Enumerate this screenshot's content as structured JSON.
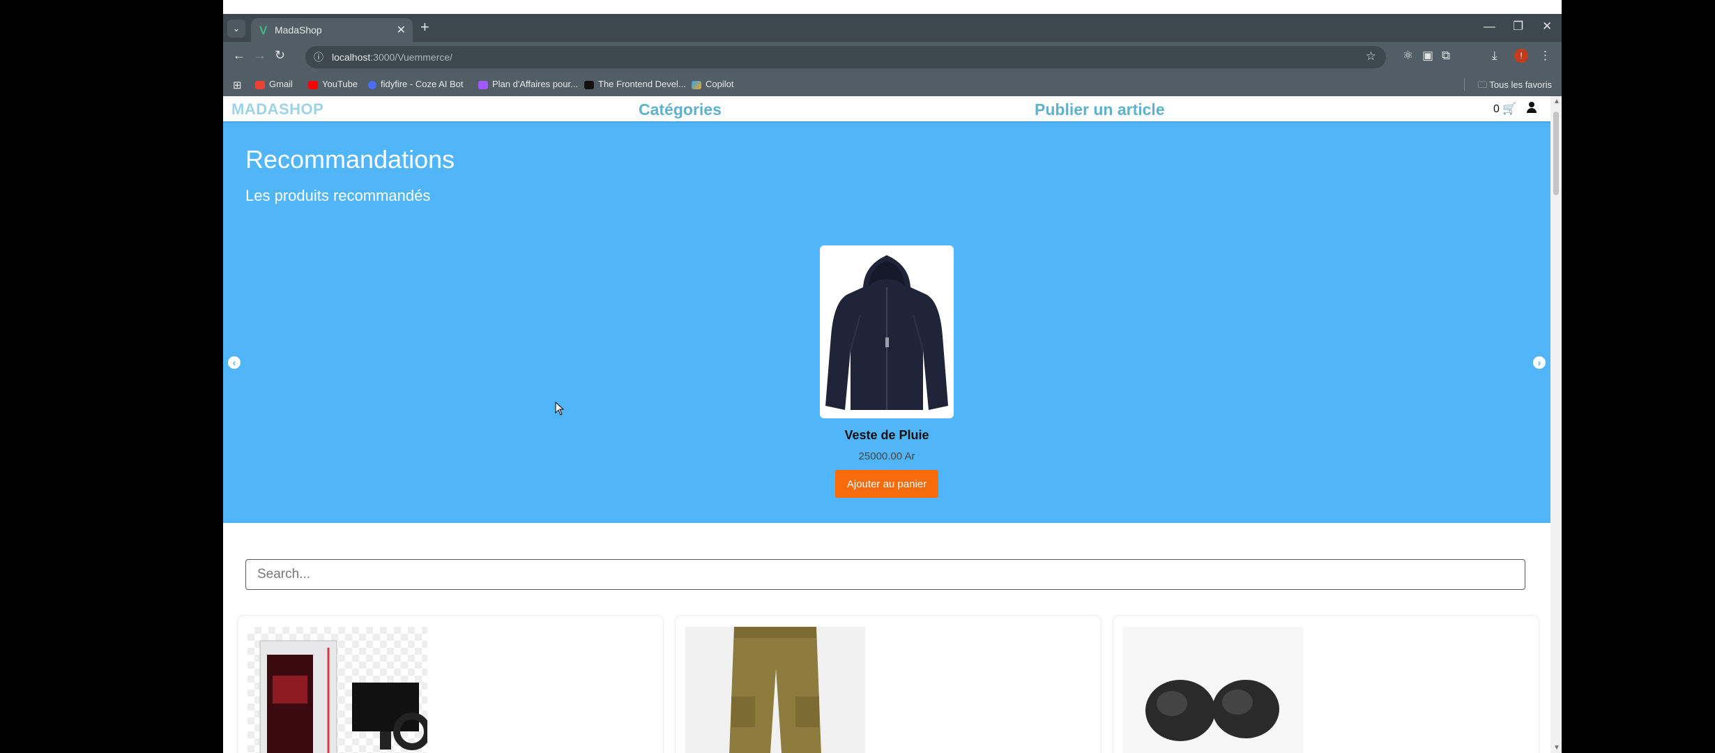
{
  "browser": {
    "tab_title": "MadaShop",
    "url_host": "localhost",
    "url_path": ":3000/Vuemmerce/",
    "profile_initial": "!",
    "bookmarks": [
      {
        "label": "Gmail",
        "color": "#ea4335"
      },
      {
        "label": "YouTube",
        "color": "#ff0000"
      },
      {
        "label": "fidyfire - Coze AI Bot",
        "color": "#4b6ef5"
      },
      {
        "label": "Plan d'Affaires pour...",
        "color": "#a259ff"
      },
      {
        "label": "The Frontend Devel...",
        "color": "#111111"
      },
      {
        "label": "Copilot",
        "color": "#2aa1f0"
      }
    ],
    "all_bookmarks": "Tous les favoris"
  },
  "site": {
    "brand": "MADASHOP",
    "nav_categories": "Catégories",
    "nav_publish": "Publier un article",
    "cart_count": "0"
  },
  "hero": {
    "title": "Recommandations",
    "subtitle": "Les produits recommandés",
    "product": {
      "name": "Veste de Pluie",
      "price": "25000.00 Ar",
      "add_button": "Ajouter au panier"
    }
  },
  "search": {
    "placeholder": "Search..."
  },
  "products": [
    {
      "name": "gaming-pc"
    },
    {
      "name": "cargo-pants"
    },
    {
      "name": "earbuds"
    }
  ],
  "colors": {
    "hero_bg": "#50b6f9",
    "button": "#f76b0b",
    "brand": "#9ed3e6",
    "nav_link": "#5eb2cc"
  }
}
